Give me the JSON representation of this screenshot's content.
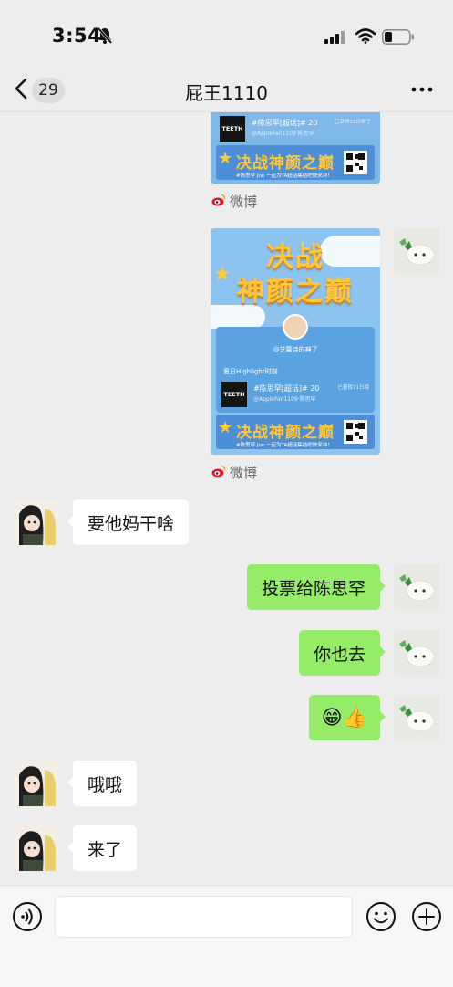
{
  "status_bar": {
    "time": "3:54"
  },
  "header": {
    "unread_count": "29",
    "title": "屁王1110"
  },
  "messages": [
    {
      "sender": "me",
      "type": "weibo_card",
      "card": {
        "topic": "#陈思罕[超话]# 20",
        "handle": "@AppleFan1109·陈思罕",
        "timestamp": "已获得21日榜了",
        "banner_title": "决战神颜之巅",
        "banner_subtitle": "#陈思罕 Jon  一起为TA超话集结吧快来冲！"
      },
      "source_label": "微博"
    },
    {
      "sender": "me",
      "type": "weibo_card",
      "card": {
        "poster_title_line1": "决战",
        "poster_title_line2": "神颜之巅",
        "owner": "@芝蕾诗的神了",
        "highlight": "夏日Highlight时刻",
        "topic": "#陈思罕[超话]# 20",
        "handle": "@AppleFan1109·陈思罕",
        "timestamp": "已获得21日榜",
        "banner_title": "决战神颜之巅",
        "banner_subtitle": "#陈思罕 Jon  一起为TA超话集结吧快来冲！"
      },
      "source_label": "微博"
    },
    {
      "sender": "friend",
      "type": "text",
      "text": "要他妈干啥"
    },
    {
      "sender": "me",
      "type": "text",
      "text": "投票给陈思罕"
    },
    {
      "sender": "me",
      "type": "text",
      "text": "你也去"
    },
    {
      "sender": "me",
      "type": "emoji",
      "text": "😁👍"
    },
    {
      "sender": "friend",
      "type": "text",
      "text": "哦哦"
    },
    {
      "sender": "friend",
      "type": "text",
      "text": "来了"
    }
  ],
  "composer": {
    "input_value": "",
    "input_placeholder": ""
  },
  "colors": {
    "background": "#ededed",
    "outgoing_bubble": "#95ec69",
    "incoming_bubble": "#ffffff",
    "card_blue": "#7fb8e8",
    "banner_gold": "#ffc63a",
    "weibo_red": "#e6162d"
  },
  "icons": {
    "status": [
      "mute-icon",
      "signal-icon",
      "wifi-icon",
      "battery-icon"
    ],
    "header": [
      "back-chevron-icon",
      "more-icon"
    ],
    "composer": [
      "voice-icon",
      "emoji-icon",
      "plus-icon"
    ],
    "source": "weibo-icon"
  }
}
